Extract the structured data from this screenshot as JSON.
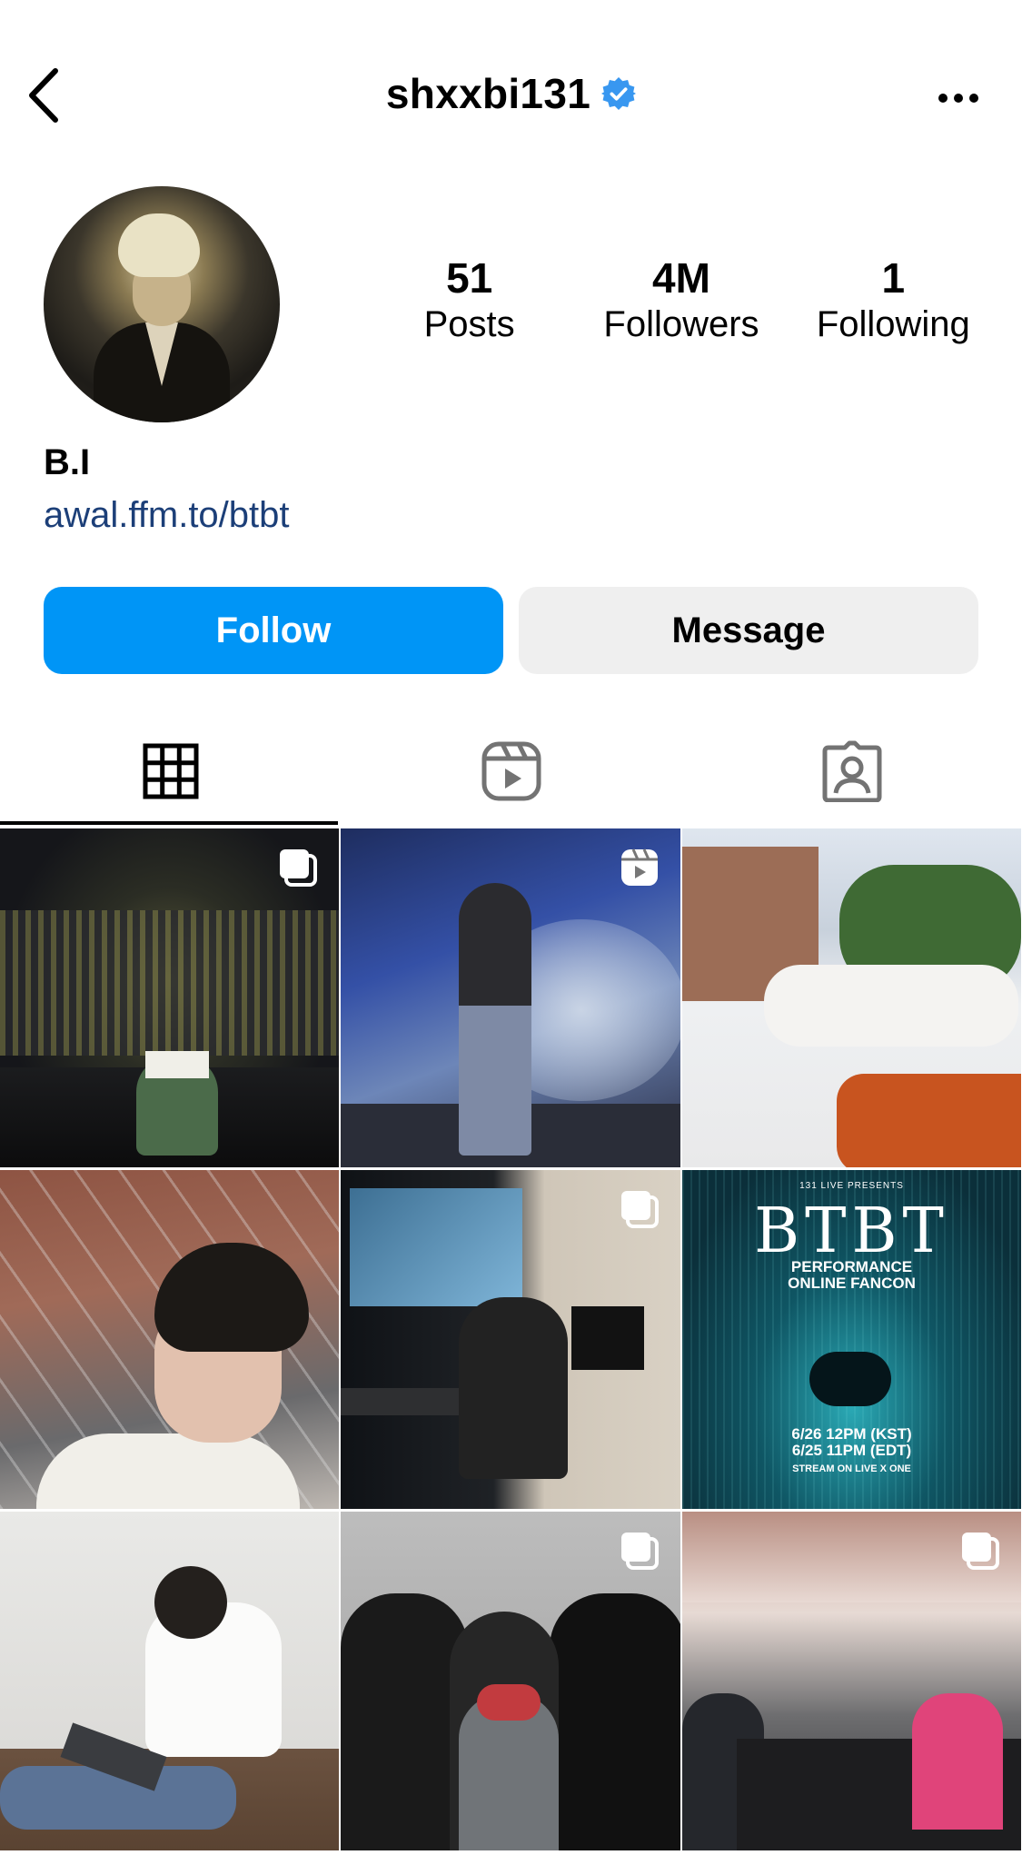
{
  "header": {
    "username": "shxxbi131",
    "verified_icon": "verified-badge-icon",
    "back_icon": "chevron-left-icon",
    "more_icon": "more-dots-icon"
  },
  "profile": {
    "stats": [
      {
        "value": "51",
        "label": "Posts"
      },
      {
        "value": "4M",
        "label": "Followers"
      },
      {
        "value": "1",
        "label": "Following"
      }
    ],
    "display_name": "B.I",
    "link": "awal.ffm.to/btbt"
  },
  "actions": {
    "follow_label": "Follow",
    "message_label": "Message",
    "follow_color": "#0095f6"
  },
  "tabs": [
    {
      "icon": "grid-icon",
      "active": true
    },
    {
      "icon": "reels-icon",
      "active": false
    },
    {
      "icon": "tagged-icon",
      "active": false
    }
  ],
  "posts": [
    {
      "type": "carousel"
    },
    {
      "type": "reel"
    },
    {
      "type": "photo"
    },
    {
      "type": "photo"
    },
    {
      "type": "carousel"
    },
    {
      "type": "photo",
      "poster": {
        "presenter": "131 LIVE PRESENTS",
        "title": "BTBT",
        "subtitle_line1": "PERFORMANCE",
        "subtitle_line2": "ONLINE FANCON",
        "date_line1": "6/26 12PM (KST)",
        "date_line2": "6/25 11PM (EDT)",
        "stream": "STREAM ON LIVE X ONE"
      }
    },
    {
      "type": "photo"
    },
    {
      "type": "carousel"
    },
    {
      "type": "carousel"
    }
  ]
}
